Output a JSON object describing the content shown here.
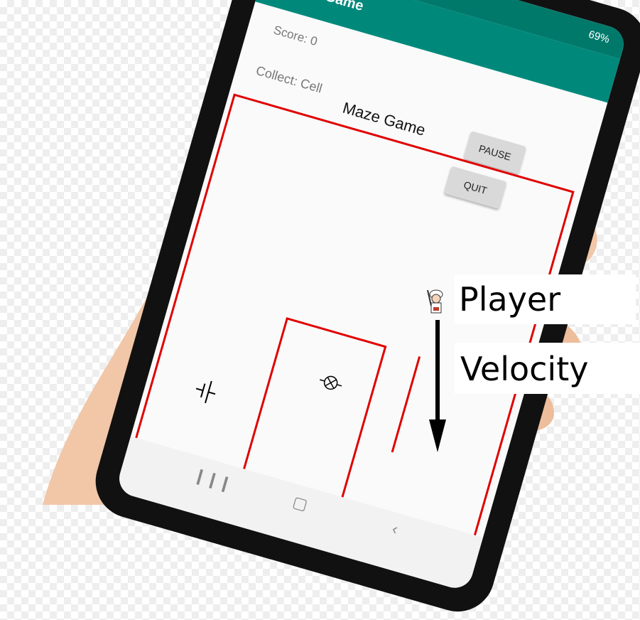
{
  "status_bar": {
    "battery": "69%"
  },
  "app_bar": {
    "title": "Maze Game"
  },
  "game": {
    "score_text": "Score: 0",
    "collect_text": "Collect: Cell",
    "title": "Maze Game",
    "pause_label": "PAUSE",
    "quit_label": "QUIT"
  },
  "icons": {
    "cell": "battery-cell-icon",
    "lamp": "lamp-icon",
    "player": "player-icon"
  },
  "annotations": {
    "player_label": "Player",
    "velocity_label": "Velocity"
  },
  "colors": {
    "app_bar": "#00897b",
    "status_bar": "#00796b",
    "maze_walls": "#e00000",
    "bezel": "#111111"
  }
}
